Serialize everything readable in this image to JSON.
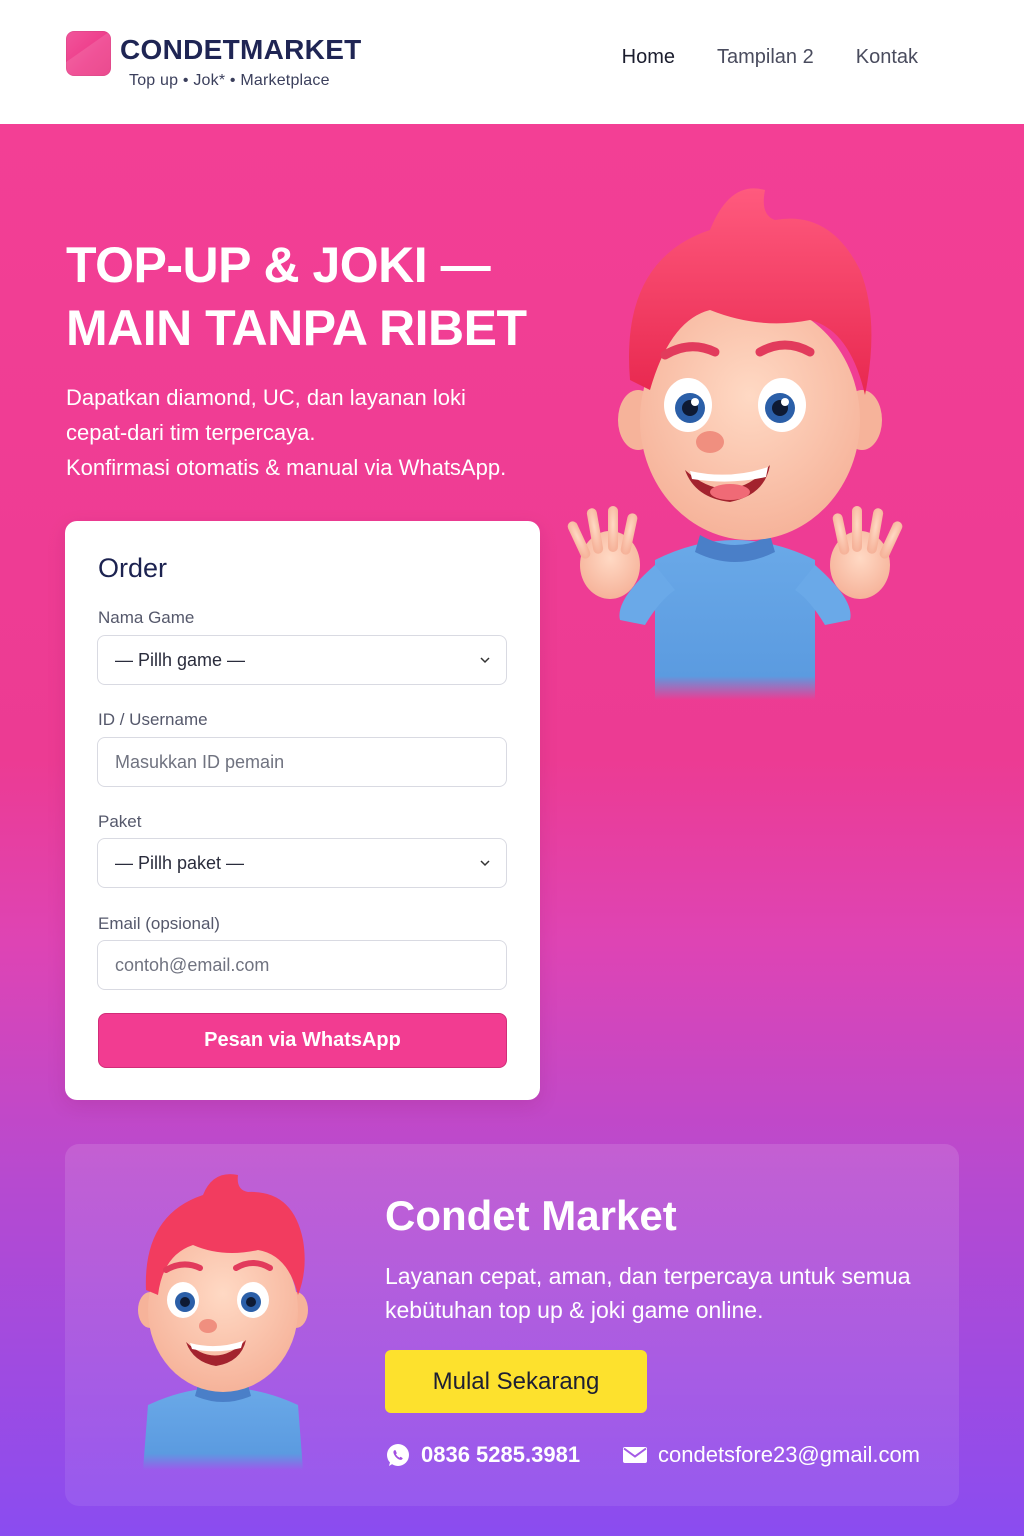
{
  "header": {
    "brand_title": "CONDETMARKET",
    "brand_subtitle": "Top  up • Jok* • Marketplace",
    "nav": [
      "Home",
      "Tampilan 2",
      "Kontak"
    ],
    "active_nav": "Home"
  },
  "hero": {
    "title_line1": "TOP-UP & JOKI —",
    "title_line2": "MAIN TANPA RIBET",
    "desc_line1": "Dapatkan diamond, UC, dan layanan loki",
    "desc_line2": "cepat-dari tim terpercaya.",
    "desc_line3": "Konfirmasi otomatis & manual via WhatsApp."
  },
  "order": {
    "title": "Order",
    "game_label": "Nama Game",
    "game_value": "— Pillh game —",
    "id_label": "ID / Username",
    "id_placeholder": "Masukkan ID pemain",
    "package_label": "Paket",
    "package_value": "— Pillh paket —",
    "email_label": "Email (opsional)",
    "email_placeholder": "contoh@email.com",
    "submit_label": "Pesan via WhatsApp"
  },
  "promo": {
    "title": "Condet Market",
    "desc_line1": "Layanan cepat, aman, dan terpercaya untuk semua",
    "desc_line2": "kebütuhan top up & joki game online.",
    "cta_label": "Mulal Sekarang",
    "phone": "0836 5285.3981",
    "email": "condetsfore23@gmail.com"
  },
  "colors": {
    "brand_pink": "#f23c91",
    "navy": "#1f2554",
    "cta_yellow": "#fde12d",
    "bottom_purple": "#8a4cf0"
  },
  "icons": [
    "whatsapp-icon",
    "mail-icon",
    "chevron-down-icon"
  ]
}
